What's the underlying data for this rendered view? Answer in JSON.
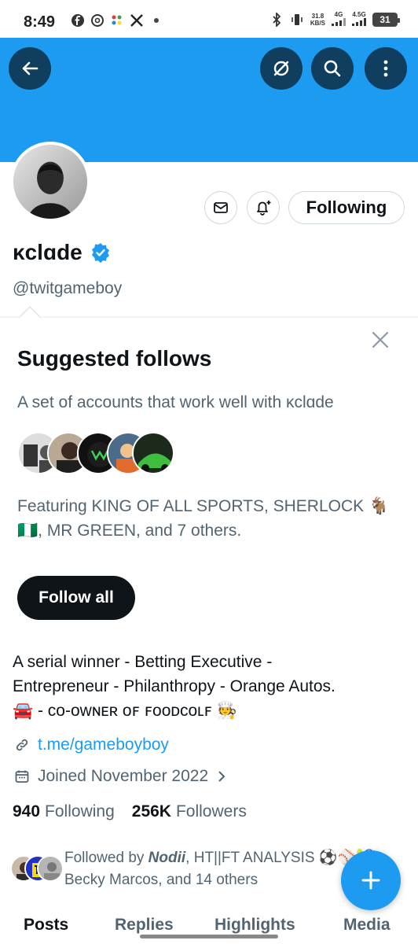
{
  "status_bar": {
    "time": "8:49",
    "net_speed": "31.8",
    "net_unit": "KB/S",
    "sig1": "4G",
    "sig2": "4.5G",
    "battery": "31"
  },
  "profile": {
    "display_name": "κclɑde",
    "handle": "@twitgameboy",
    "following_button": "Following"
  },
  "suggested": {
    "title": "Suggested follows",
    "subtitle": "A set of accounts that work well with κclɑde",
    "featuring": "Featuring KING OF ALL SPORTS, SHERLOCK 🐐🇳🇬, MR GREEN, and 7 others.",
    "follow_all": "Follow all"
  },
  "bio": {
    "line1": "A serial winner - Betting Executive -",
    "line2": "Entrepreneur - Philanthropy - Orange Autos.",
    "line3": "🚘 - ᴄᴏ-ᴏᴡɴᴇʀ ᴏꜰ ꜰᴏᴏᴅᴄᴏʟꜰ 🧑‍🍳",
    "link": "t.me/gameboyboy",
    "joined": "Joined November 2022"
  },
  "counts": {
    "following_num": "940",
    "following_label": "Following",
    "followers_num": "256K",
    "followers_label": "Followers"
  },
  "followed_by": {
    "prefix": "Followed by ",
    "name1": "Nodii",
    "rest1": ", HT||FT ANALYSIS ⚽️⚾️🎾,",
    "rest2": "Becky Marcos, and 14 others"
  },
  "tabs": [
    "Posts",
    "Replies",
    "Highlights",
    "Media"
  ],
  "colors": {
    "accent": "#1d9bf0",
    "text": "#0f1419",
    "muted": "#536471"
  }
}
